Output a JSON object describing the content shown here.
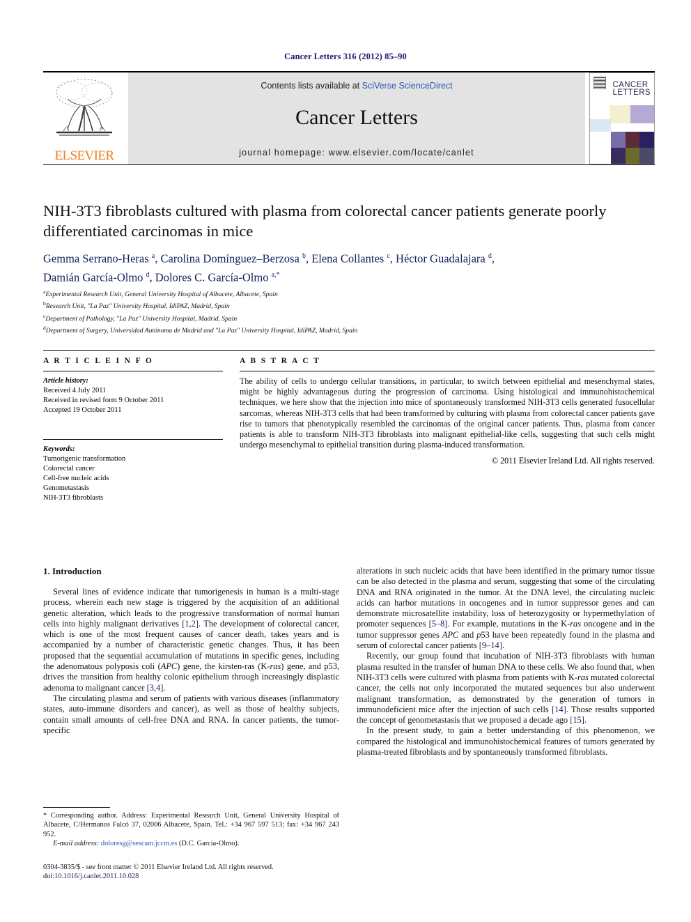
{
  "running_head": "Cancer Letters 316 (2012) 85–90",
  "header": {
    "publisher_wordmark": "ELSEVIER",
    "contents_prefix": "Contents lists available at ",
    "contents_link": "SciVerse ScienceDirect",
    "journal_title": "Cancer Letters",
    "homepage": "journal homepage: www.elsevier.com/locate/canlet",
    "cover_title_line1": "CANCER",
    "cover_title_line2": "LETTERS"
  },
  "article": {
    "title": "NIH-3T3 fibroblasts cultured with plasma from colorectal cancer patients generate poorly differentiated carcinomas in mice",
    "authors_html": "Gemma Serrano-Heras <sup>a</sup>, Carolina Domínguez–Berzosa <sup>b</sup>, Elena Collantes <sup>c</sup>, Héctor Guadalajara <sup>d</sup>, Damián García-Olmo <sup>d</sup>, Dolores C. García-Olmo <sup>a,*</sup>",
    "affiliations": [
      {
        "mark": "a",
        "text": "Experimental Research Unit, General University Hospital of Albacete, Albacete, Spain"
      },
      {
        "mark": "b",
        "text": "Research Unit, \"La Paz\" University Hospital, IdiPAZ, Madrid, Spain"
      },
      {
        "mark": "c",
        "text": "Department of Pathology, \"La Paz\" University Hospital, Madrid, Spain"
      },
      {
        "mark": "d",
        "text": "Department of Surgery, Universidad Autónoma de Madrid and \"La Paz\" University Hospital, IdiPAZ, Madrid, Spain"
      }
    ]
  },
  "article_info": {
    "heading": "A R T I C L E   I N F O",
    "history_label": "Article history:",
    "history": [
      "Received 4 July 2011",
      "Received in revised form 9 October 2011",
      "Accepted 19 October 2011"
    ],
    "keywords_label": "Keywords:",
    "keywords": [
      "Tumorigenic transformation",
      "Colorectal cancer",
      "Cell-free nucleic acids",
      "Genometastasis",
      "NIH-3T3 fibroblasts"
    ]
  },
  "abstract": {
    "heading": "A B S T R A C T",
    "text": "The ability of cells to undergo cellular transitions, in particular, to switch between epithelial and mesenchymal states, might be highly advantageous during the progression of carcinoma. Using histological and immunohistochemical techniques, we here show that the injection into mice of spontaneously transformed NIH-3T3 cells generated fusocellular sarcomas, whereas NIH-3T3 cells that had been transformed by culturing with plasma from colorectal cancer patients gave rise to tumors that phenotypically resembled the carcinomas of the original cancer patients. Thus, plasma from cancer patients is able to transform NIH-3T3 fibroblasts into malignant epithelial-like cells, suggesting that such cells might undergo mesenchymal to epithelial transition during plasma-induced transformation.",
    "copyright": "© 2011 Elsevier Ireland Ltd. All rights reserved."
  },
  "body": {
    "section1_heading": "1. Introduction",
    "left_paragraphs": [
      "Several lines of evidence indicate that tumorigenesis in human is a multi-stage process, wherein each new stage is triggered by the acquisition of an additional genetic alteration, which leads to the progressive transformation of normal human cells into highly malignant derivatives [1,2]. The development of colorectal cancer, which is one of the most frequent causes of cancer death, takes years and is accompanied by a number of characteristic genetic changes. Thus, it has been proposed that the sequential accumulation of mutations in specific genes, including the adenomatous polyposis coli (APC) gene, the kirsten-ras (K-ras) gene, and p53, drives the transition from healthy colonic epithelium through increasingly displastic adenoma to malignant cancer [3,4].",
      "The circulating plasma and serum of patients with various diseases (inflammatory states, auto-immune disorders and cancer), as well as those of healthy subjects, contain small amounts of cell-free DNA and RNA. In cancer patients, the tumor-specific"
    ],
    "right_paragraphs": [
      "alterations in such nucleic acids that have been identified in the primary tumor tissue can be also detected in the plasma and serum, suggesting that some of the circulating DNA and RNA originated in the tumor. At the DNA level, the circulating nucleic acids can harbor mutations in oncogenes and in tumor suppressor genes and can demonstrate microsatellite instability, loss of heterozygosity or hypermethylation of promoter sequences [5–8]. For example, mutations in the K-ras oncogene and in the tumor suppressor genes APC and p53 have been repeatedly found in the plasma and serum of colorectal cancer patients [9–14].",
      "Recently, our group found that incubation of NIH-3T3 fibroblasts with human plasma resulted in the transfer of human DNA to these cells. We also found that, when NIH-3T3 cells were cultured with plasma from patients with K-ras mutated colorectal cancer, the cells not only incorporated the mutated sequences but also underwent malignant transformation, as demonstrated by the generation of tumors in immunodeficient mice after the injection of such cells [14]. Those results supported the concept of genometastasis that we proposed a decade ago [15].",
      "In the present study, to gain a better understanding of this phenomenon, we compared the histological and immunohistochemical features of tumors generated by plasma-treated fibroblasts and by spontaneously transformed fibroblasts."
    ]
  },
  "footnote": {
    "corresponding": "* Corresponding author. Address: Experimental Research Unit, General University Hospital of Albacete, C/Hermanos Falcó 37, 02006 Albacete, Spain. Tel.: +34 967 597 513; fax: +34 967 243 952.",
    "email_label": "E-mail address:",
    "email": "doloresg@sescam.jccm.es",
    "email_owner": "(D.C. García-Olmo)."
  },
  "colophon": {
    "front_matter": "0304-3835/$ - see front matter © 2011 Elsevier Ireland Ltd. All rights reserved.",
    "doi_label": "doi:",
    "doi": "10.1016/j.canlet.2011.10.028"
  },
  "colors": {
    "navy": "#16205e",
    "link_blue": "#2a55b5",
    "elsevier_orange": "#ef7d1a",
    "banner_gray": "#e3e3e3"
  }
}
